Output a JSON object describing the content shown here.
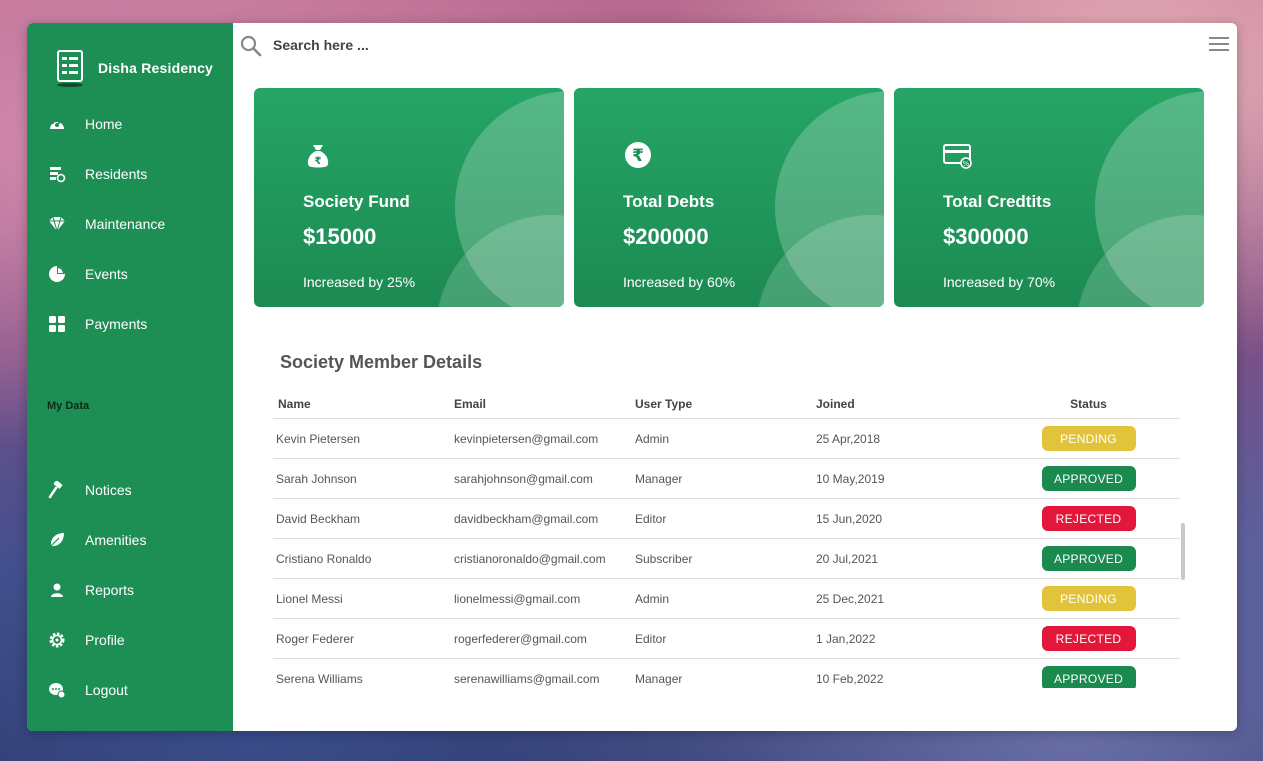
{
  "brand": {
    "name": "Disha Residency",
    "icon": "building-list-icon"
  },
  "sidebar": {
    "items": [
      {
        "label": "Home",
        "icon": "dashboard-gauge-icon"
      },
      {
        "label": "Residents",
        "icon": "residents-list-icon"
      },
      {
        "label": "Maintenance",
        "icon": "diamond-icon"
      },
      {
        "label": "Events",
        "icon": "pie-chart-icon"
      },
      {
        "label": "Payments",
        "icon": "grid-icon"
      }
    ],
    "section_label": "My Data",
    "data_items": [
      {
        "label": "Notices",
        "icon": "hammer-icon"
      },
      {
        "label": "Amenities",
        "icon": "leaf-icon"
      },
      {
        "label": "Reports",
        "icon": "user-icon"
      },
      {
        "label": "Profile",
        "icon": "gear-icon"
      },
      {
        "label": "Logout",
        "icon": "chat-icon"
      }
    ]
  },
  "search": {
    "placeholder": "Search here ..."
  },
  "cards": [
    {
      "title": "Society Fund",
      "value": "$15000",
      "subtitle": "Increased by 25%",
      "icon": "money-bag-icon"
    },
    {
      "title": "Total Debts",
      "value": "$200000",
      "subtitle": "Increased by 60%",
      "icon": "rupee-coin-icon"
    },
    {
      "title": "Total Credtits",
      "value": "$300000",
      "subtitle": "Increased by 70%",
      "icon": "credit-card-icon"
    }
  ],
  "members": {
    "title": "Society Member Details",
    "headers": {
      "name": "Name",
      "email": "Email",
      "type": "User Type",
      "joined": "Joined",
      "status": "Status"
    },
    "rows": [
      {
        "name": "Kevin Pietersen",
        "email": "kevinpietersen@gmail.com",
        "type": "Admin",
        "joined": "25 Apr,2018",
        "status": "PENDING"
      },
      {
        "name": "Sarah Johnson",
        "email": "sarahjohnson@gmail.com",
        "type": "Manager",
        "joined": "10 May,2019",
        "status": "APPROVED"
      },
      {
        "name": "David Beckham",
        "email": "davidbeckham@gmail.com",
        "type": "Editor",
        "joined": "15 Jun,2020",
        "status": "REJECTED"
      },
      {
        "name": "Cristiano Ronaldo",
        "email": "cristianoronaldo@gmail.com",
        "type": "Subscriber",
        "joined": "20 Jul,2021",
        "status": "APPROVED"
      },
      {
        "name": "Lionel Messi",
        "email": "lionelmessi@gmail.com",
        "type": "Admin",
        "joined": "25 Dec,2021",
        "status": "PENDING"
      },
      {
        "name": "Roger Federer",
        "email": "rogerfederer@gmail.com",
        "type": "Editor",
        "joined": "1 Jan,2022",
        "status": "REJECTED"
      },
      {
        "name": "Serena Williams",
        "email": "serenawilliams@gmail.com",
        "type": "Manager",
        "joined": "10 Feb,2022",
        "status": "APPROVED"
      }
    ]
  },
  "colors": {
    "sidebar": "#1e8f54",
    "card": "#22a060",
    "pending": "#e2c43c",
    "approved": "#1a8a4e",
    "rejected": "#e3173a"
  }
}
